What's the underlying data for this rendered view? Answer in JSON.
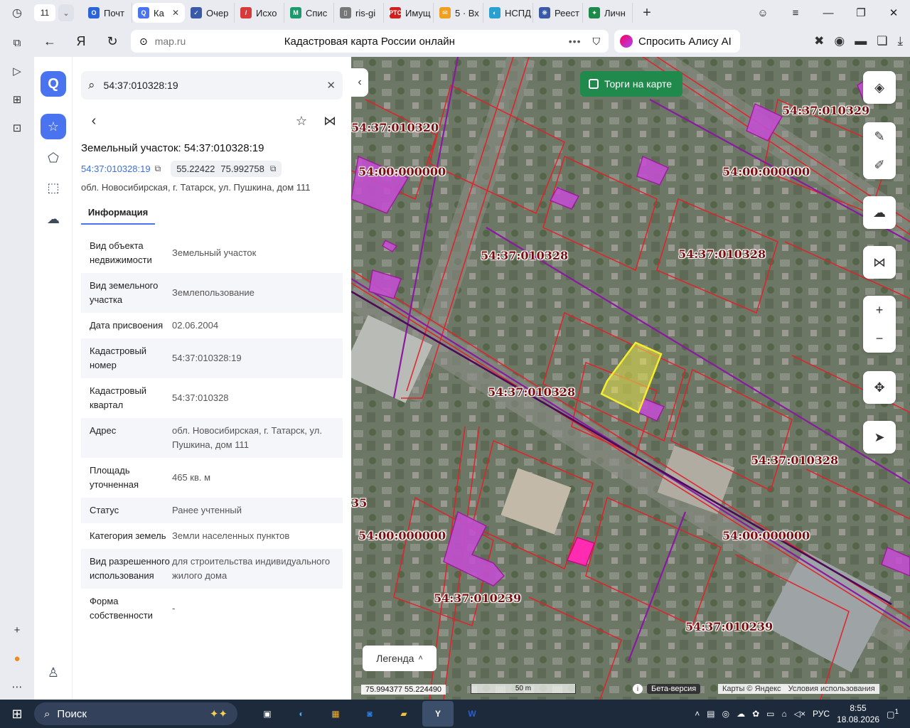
{
  "browser": {
    "tab_count": "11",
    "tabs": [
      {
        "label": "Почт",
        "color": "#2b63d9",
        "glyph": "O"
      },
      {
        "label": "Ка",
        "color": "#4a73f0",
        "glyph": "Q",
        "active": true
      },
      {
        "label": "Очер",
        "color": "#3a5aa8",
        "glyph": "✓"
      },
      {
        "label": "Исхо",
        "color": "#d63a3a",
        "glyph": "/"
      },
      {
        "label": "Спис",
        "color": "#1c9a6c",
        "glyph": "M"
      },
      {
        "label": "ris-gi",
        "color": "#777777",
        "glyph": "▯"
      },
      {
        "label": "Имущ",
        "color": "#d02020",
        "glyph": "РТС"
      },
      {
        "label": "5 · Вх",
        "color": "#f0a020",
        "glyph": "✉"
      },
      {
        "label": "НСПД",
        "color": "#2aa0d0",
        "glyph": "◐"
      },
      {
        "label": "Реест",
        "color": "#3a5aa8",
        "glyph": "❋"
      },
      {
        "label": "Личн",
        "color": "#1e8a4a",
        "glyph": "✦"
      }
    ],
    "url_host": "map.ru",
    "page_title": "Кадастровая карта России онлайн",
    "alice_label": "Спросить Алису AI"
  },
  "panel": {
    "search_value": "54:37:010328:19",
    "title": "Земельный участок: 54:37:010328:19",
    "cad_number_link": "54:37:010328:19",
    "coords_lat": "55.22422",
    "coords_lon": "75.992758",
    "address_line": "обл. Новосибирская, г. Татарск, ул. Пушкина, дом 111",
    "tab_info": "Информация",
    "rows": [
      {
        "key": "Вид объекта недвижимости",
        "value": "Земельный участок"
      },
      {
        "key": "Вид земельного участка",
        "value": "Землепользование"
      },
      {
        "key": "Дата присвоения",
        "value": "02.06.2004"
      },
      {
        "key": "Кадастровый номер",
        "value": "54:37:010328:19"
      },
      {
        "key": "Кадастровый квартал",
        "value": "54:37:010328"
      },
      {
        "key": "Адрес",
        "value": "обл. Новосибирская, г. Татарск, ул. Пушкина, дом 111"
      },
      {
        "key": "Площадь уточненная",
        "value": "465 кв. м"
      },
      {
        "key": "Статус",
        "value": "Ранее учтенный"
      },
      {
        "key": "Категория земель",
        "value": "Земли населенных пунктов"
      },
      {
        "key": "Вид разрешенного использования",
        "value": "для строительства индивидуального жилого дома"
      },
      {
        "key": "Форма собственности",
        "value": "-"
      }
    ]
  },
  "map": {
    "torgi_label": "Торги на карте",
    "legend_label": "Легенда",
    "cursor_coords": "75.994377   55.224490",
    "scale_label": "50 m",
    "beta_label": "Бета-версия",
    "copyright": "Карты © Яндекс",
    "terms": "Условия использования",
    "quarter_labels": [
      "54:37:010320",
      "54:00:000000",
      "54:37:010329",
      "54:00:000000",
      "54:37:010328",
      "54:37:010328",
      "54:37:010328",
      "54:37:010328",
      "35",
      "54:00:000000",
      "54:00:000000",
      "54:37:010239",
      "54:37:010239"
    ]
  },
  "taskbar": {
    "search_label": "Поиск",
    "lang": "РУС",
    "time": "8:55",
    "date": "18.08.2026",
    "notif_count": "1"
  }
}
